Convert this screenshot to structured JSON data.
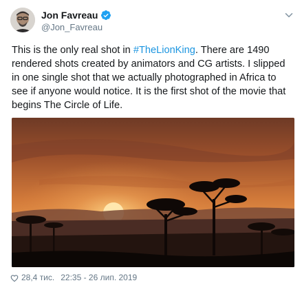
{
  "author": {
    "name": "Jon Favreau",
    "handle": "@Jon_Favreau",
    "verified": true
  },
  "tweet": {
    "text_before": "This is the only real shot in ",
    "hashtag": "#TheLionKing",
    "text_after": ". There are 1490 rendered shots created by animators and CG artists. I slipped in one single shot that we actually photographed in Africa to see if anyone would notice. It is the first shot of the movie that begins The Circle of Life."
  },
  "footer": {
    "likes": "28,4 тис.",
    "timestamp": "22:35 - 26 лип. 2019"
  },
  "colors": {
    "link": "#1b95e0",
    "verified": "#1da1f2",
    "muted": "#657786",
    "text": "#14171a"
  },
  "icons": {
    "verified": "verified-badge-icon",
    "menu": "chevron-down-icon",
    "like": "heart-icon"
  }
}
